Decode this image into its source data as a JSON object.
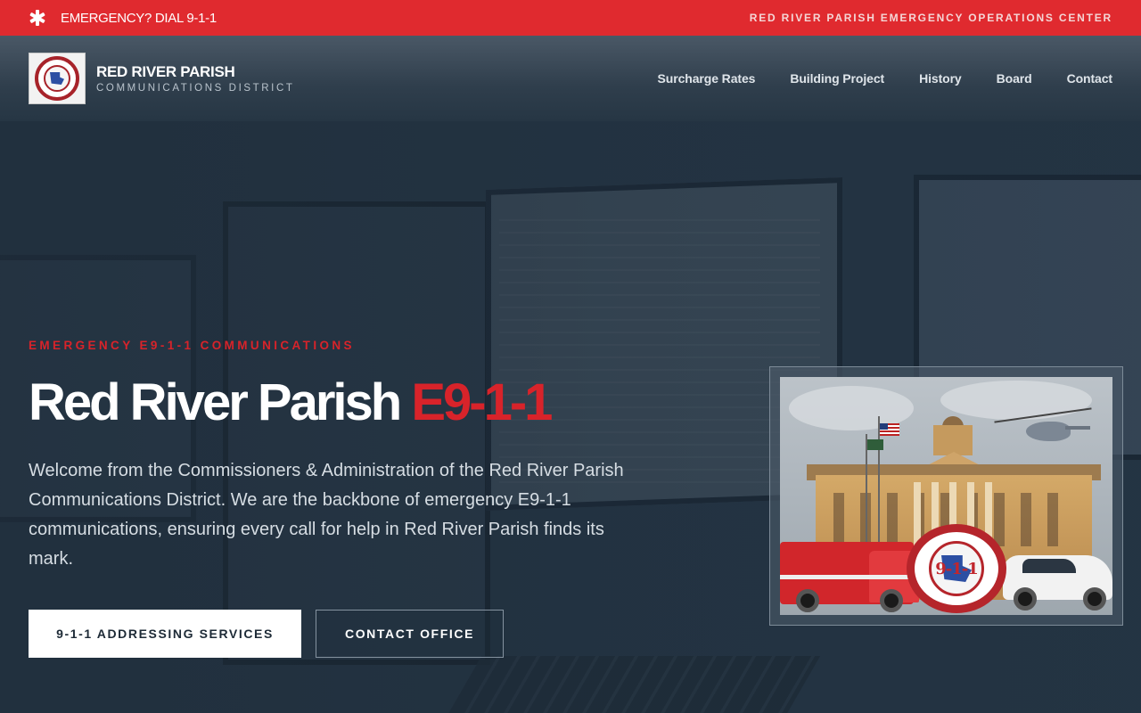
{
  "topbar": {
    "emergency": "EMERGENCY? DIAL 9-1-1",
    "center": "RED RIVER PARISH EMERGENCY OPERATIONS CENTER",
    "icon": "star-of-life-icon"
  },
  "brand": {
    "title": "RED RIVER PARISH",
    "subtitle": "COMMUNICATIONS DISTRICT",
    "logo_icon": "parish-911-seal-icon"
  },
  "nav": {
    "items": [
      {
        "label": "Surcharge Rates"
      },
      {
        "label": "Building Project"
      },
      {
        "label": "History"
      },
      {
        "label": "Board"
      },
      {
        "label": "Contact"
      }
    ]
  },
  "hero": {
    "eyebrow": "EMERGENCY E9-1-1 COMMUNICATIONS",
    "title_main": "Red River Parish ",
    "title_accent": "E9-1-1",
    "description": "Welcome from the Commissioners & Administration of the Red River Parish Communications District. We are the backbone of emergency E9-1-1 communications, ensuring every call for help in Red River Parish finds its mark.",
    "primary_button": "9-1-1 ADDRESSING SERVICES",
    "secondary_button": "CONTACT OFFICE",
    "seal_number": "9-1-1"
  },
  "colors": {
    "alert_red": "#e02a2f",
    "accent_red": "#d8232a",
    "hero_bg": "#1f2d3a",
    "text_light": "#d6dde3"
  }
}
